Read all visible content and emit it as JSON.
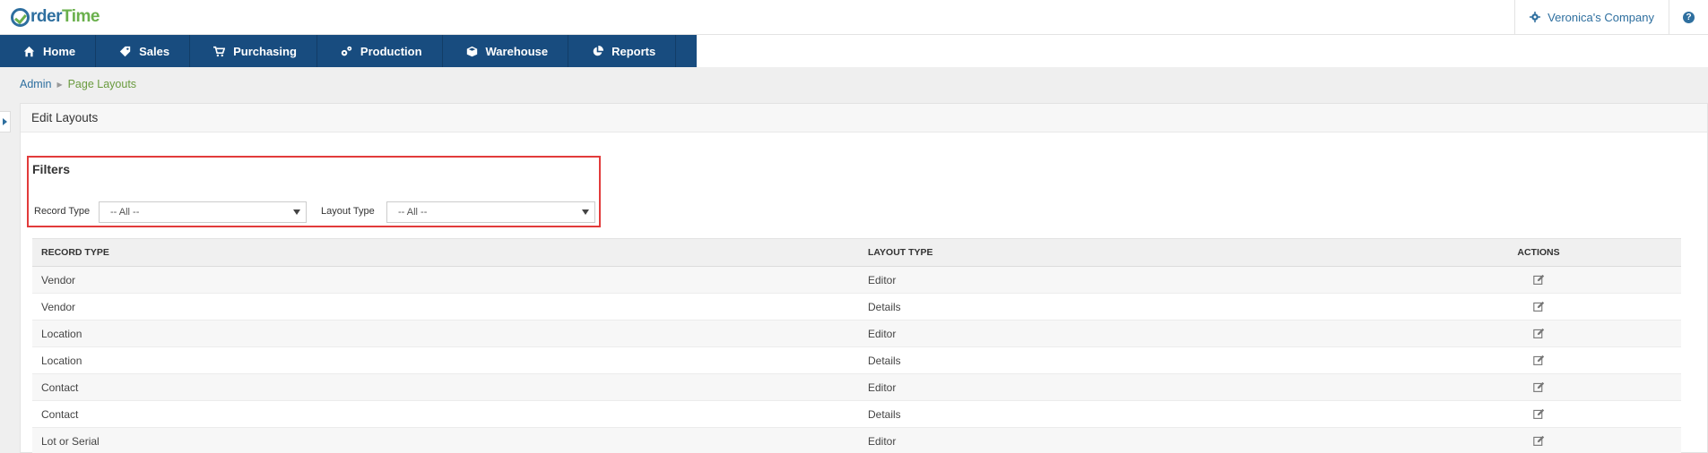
{
  "app": {
    "logo_part1": "rder",
    "logo_part2": "Time"
  },
  "header": {
    "company": "Veronica's Company",
    "help": "?"
  },
  "nav": [
    {
      "label": "Home",
      "icon": "home-icon"
    },
    {
      "label": "Sales",
      "icon": "tag-icon"
    },
    {
      "label": "Purchasing",
      "icon": "cart-icon"
    },
    {
      "label": "Production",
      "icon": "gears-icon"
    },
    {
      "label": "Warehouse",
      "icon": "cube-icon"
    },
    {
      "label": "Reports",
      "icon": "pie-chart-icon"
    }
  ],
  "breadcrumb": {
    "parent": "Admin",
    "current": "Page Layouts"
  },
  "panel": {
    "title": "Edit Layouts"
  },
  "filters": {
    "title": "Filters",
    "record_type_label": "Record Type",
    "record_type_value": "-- All --",
    "layout_type_label": "Layout Type",
    "layout_type_value": "-- All --"
  },
  "table": {
    "headers": {
      "record_type": "RECORD TYPE",
      "layout_type": "LAYOUT TYPE",
      "actions": "ACTIONS"
    },
    "rows": [
      {
        "record_type": "Vendor",
        "layout_type": "Editor"
      },
      {
        "record_type": "Vendor",
        "layout_type": "Details"
      },
      {
        "record_type": "Location",
        "layout_type": "Editor"
      },
      {
        "record_type": "Location",
        "layout_type": "Details"
      },
      {
        "record_type": "Contact",
        "layout_type": "Editor"
      },
      {
        "record_type": "Contact",
        "layout_type": "Details"
      },
      {
        "record_type": "Lot or Serial",
        "layout_type": "Editor"
      }
    ]
  },
  "colors": {
    "nav_bg": "#184c7f",
    "link": "#2e6f9f",
    "accent_green": "#6ab04c",
    "highlight": "#e23b3b"
  }
}
